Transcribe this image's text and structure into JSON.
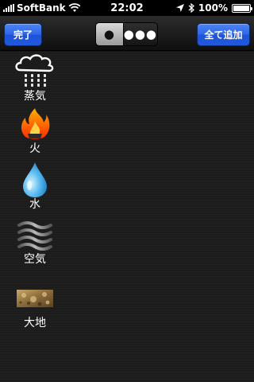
{
  "status": {
    "carrier": "SoftBank",
    "time": "22:02",
    "battery": "100%",
    "battery_level": 1.0
  },
  "toolbar": {
    "done_label": "完了",
    "add_all_label": "全て追加",
    "segment_single": "●",
    "segment_multi": "●●●",
    "selected_segment": "single"
  },
  "elements": [
    {
      "label": "蒸気",
      "icon": "steam-icon"
    },
    {
      "label": "火",
      "icon": "fire-icon"
    },
    {
      "label": "水",
      "icon": "water-drop-icon"
    },
    {
      "label": "空気",
      "icon": "air-icon"
    },
    {
      "label": "大地",
      "icon": "earth-icon"
    }
  ],
  "colors": {
    "button_blue": "#2f66e6",
    "background": "#1c1c1c"
  }
}
